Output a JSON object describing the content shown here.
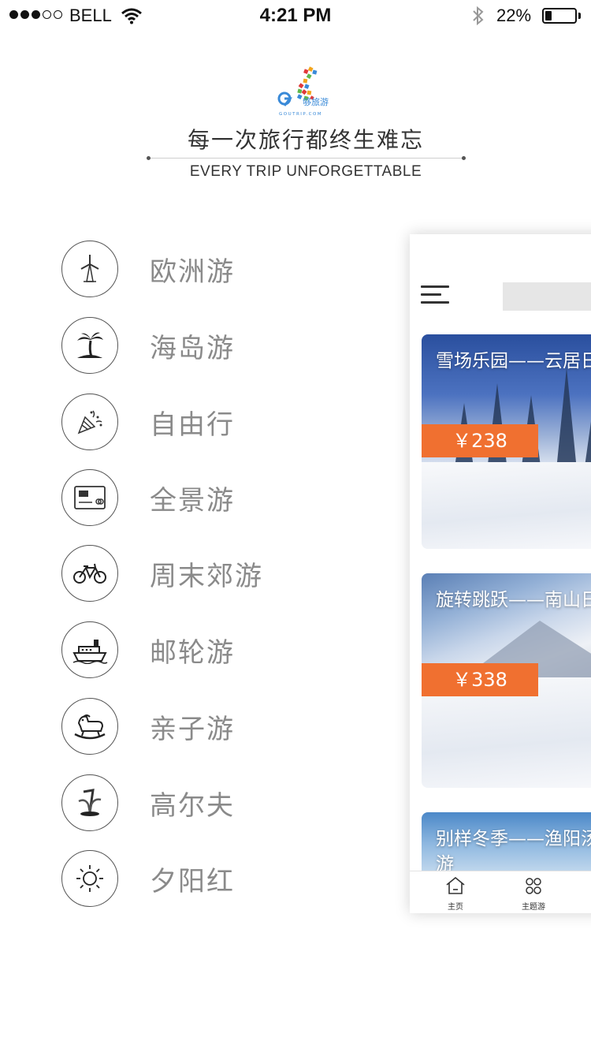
{
  "status_bar": {
    "carrier": "BELL",
    "time": "4:21 PM",
    "battery": "22%",
    "battery_level": 0.22,
    "signal_bars_filled": 3,
    "signal_bars_total": 5
  },
  "header": {
    "logo_text": "够旅游",
    "logo_sub": "GOUTRIP.COM",
    "slogan_cn": "每一次旅行都终生难忘",
    "slogan_en": "EVERY TRIP UNFORGETTABLE"
  },
  "menu": {
    "items": [
      {
        "label": "欧洲游",
        "icon": "windmill-icon"
      },
      {
        "label": "海岛游",
        "icon": "palm-tree-icon"
      },
      {
        "label": "自由行",
        "icon": "party-popper-icon"
      },
      {
        "label": "全景游",
        "icon": "card-icon"
      },
      {
        "label": "周末郊游",
        "icon": "bicycle-icon"
      },
      {
        "label": "邮轮游",
        "icon": "cruise-ship-icon"
      },
      {
        "label": "亲子游",
        "icon": "rocking-horse-icon"
      },
      {
        "label": "高尔夫",
        "icon": "golf-clubs-icon"
      },
      {
        "label": "夕阳红",
        "icon": "sun-icon"
      }
    ]
  },
  "preview": {
    "cards": [
      {
        "title": "雪场乐园——云居日游",
        "price": "￥238"
      },
      {
        "title": "旋转跳跃——南山日游",
        "price": "￥338"
      },
      {
        "title": "别样冬季——渔阳汤二日游",
        "price": ""
      }
    ],
    "tabs": [
      {
        "label": "主页",
        "icon": "home-icon"
      },
      {
        "label": "主题游",
        "icon": "grid-dots-icon"
      }
    ]
  },
  "colors": {
    "accent": "#f07030",
    "menu_text": "#8a8a8a",
    "icon_stroke": "#555555"
  }
}
